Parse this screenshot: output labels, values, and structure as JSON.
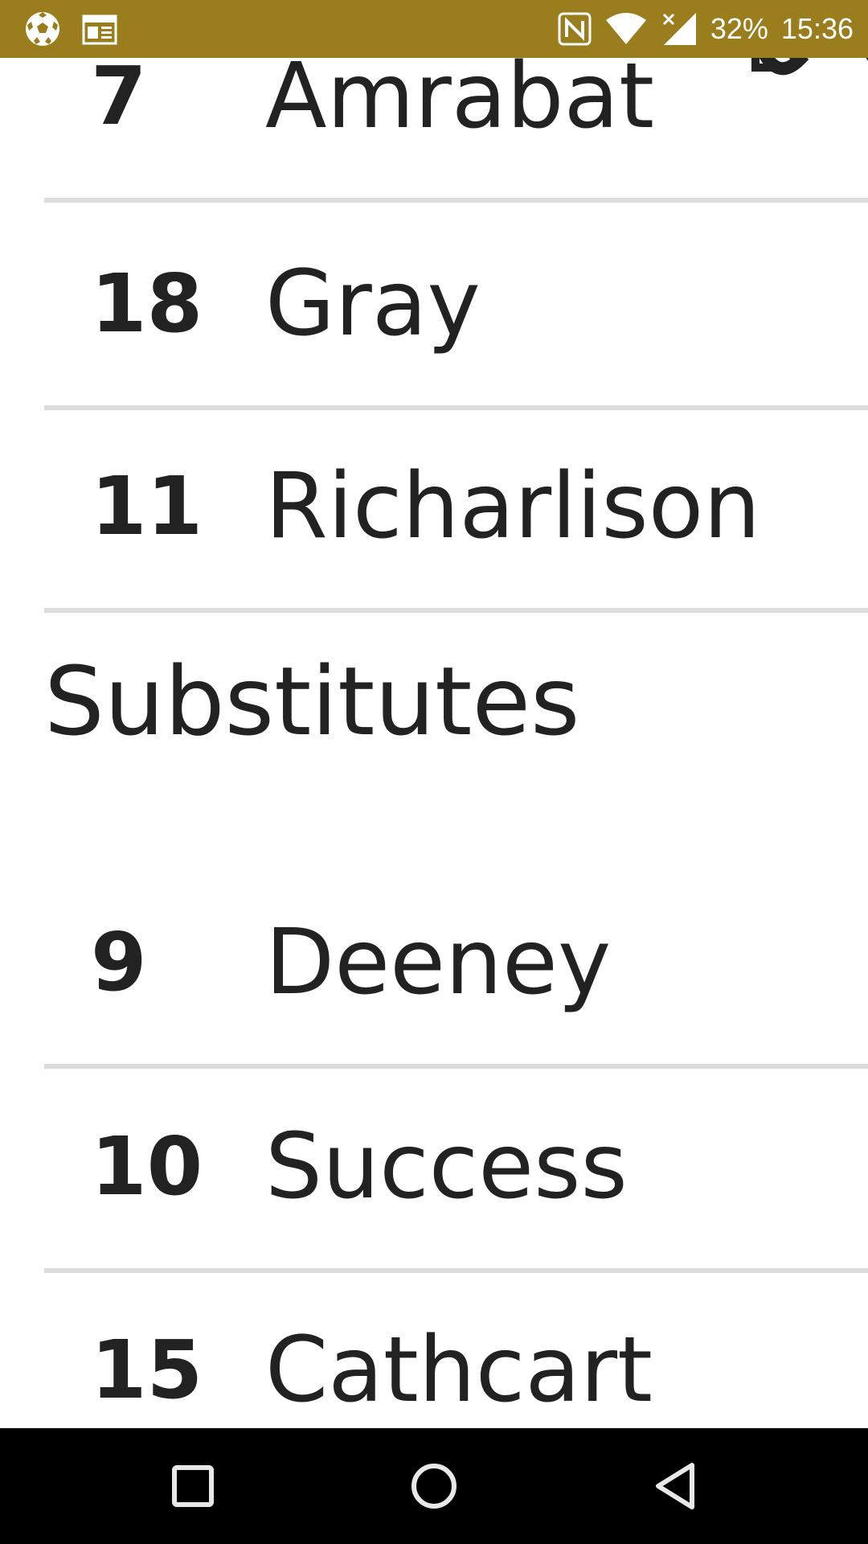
{
  "status_bar": {
    "battery": "32%",
    "time": "15:36",
    "background": "#9a7e1d",
    "icons": [
      "football-app-icon",
      "calendar-news-icon",
      "nfc-icon",
      "wifi-icon",
      "signal-icon"
    ]
  },
  "lineup": {
    "partial_player": {
      "number": "7",
      "name": "Amrabat"
    },
    "starters": [
      {
        "number": "18",
        "name": "Gray"
      },
      {
        "number": "11",
        "name": "Richarlison"
      }
    ],
    "substitutes_title": "Substitutes",
    "substitutes": [
      {
        "number": "9",
        "name": "Deeney"
      },
      {
        "number": "10",
        "name": "Success"
      },
      {
        "number": "15",
        "name": "Cathcart"
      }
    ]
  },
  "navigation": {
    "buttons": [
      "recents-button",
      "home-button",
      "back-button"
    ]
  }
}
